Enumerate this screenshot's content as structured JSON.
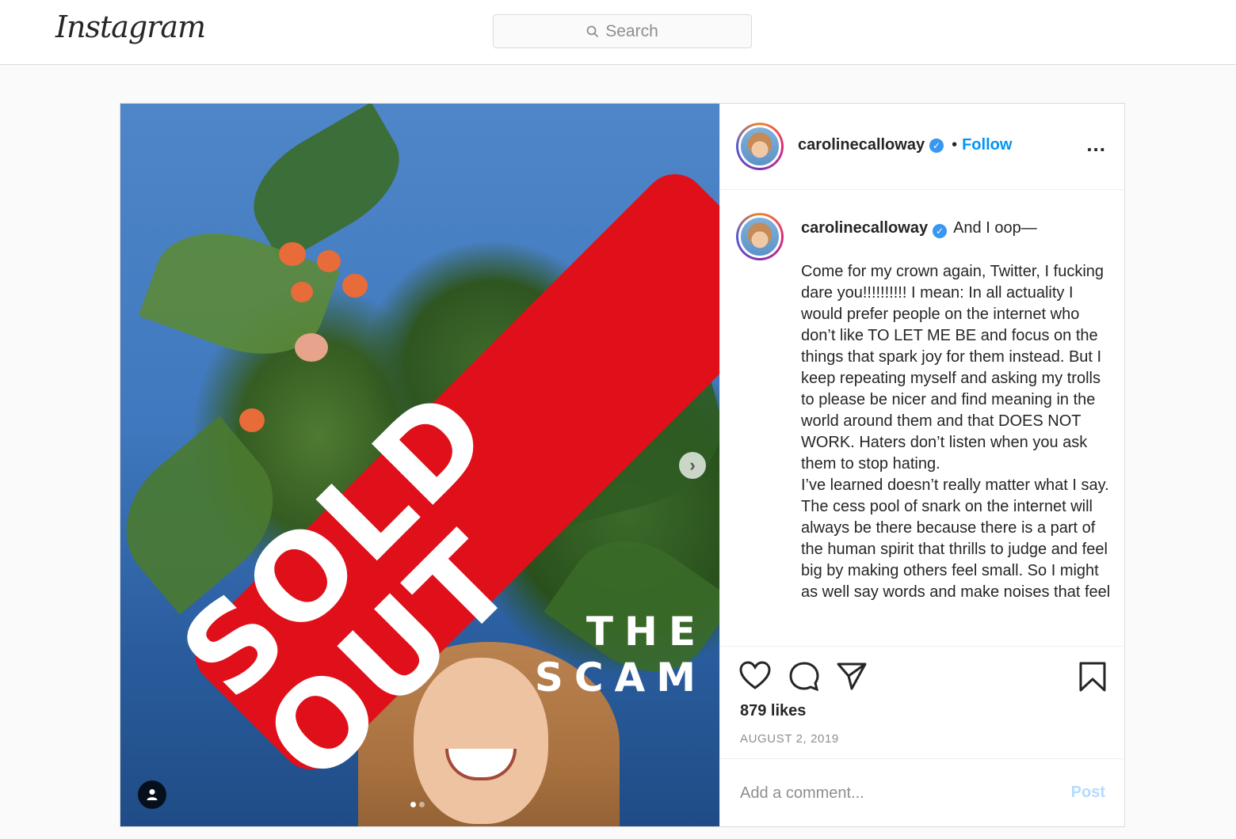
{
  "nav": {
    "logo": "Instagram",
    "search_placeholder": "Search"
  },
  "post": {
    "image": {
      "overlay_text": "SOLD OUT",
      "subtitle": "THE SCAM",
      "carousel_count": 2,
      "carousel_active": 1
    },
    "header": {
      "username": "carolinecalloway",
      "separator": "•",
      "follow_label": "Follow",
      "more_label": "..."
    },
    "caption": {
      "username": "carolinecalloway",
      "title": "And I oop—",
      "body": "Come for my crown again, Twitter, I fucking dare you!!!!!!!!!! I mean: In all actuality I would prefer people on the internet who don’t like TO LET ME BE and focus on the things that spark joy for them instead. But I keep repeating myself and asking my trolls to please be nicer and find meaning in the world around them and that DOES NOT WORK. Haters don’t listen when you ask them to stop hating.\nI’ve learned doesn’t really matter what I say. The cess pool of snark on the internet will always be there because there is a part of the human spirit that thrills to judge and feel big by making others feel small. So I might as well say words and make noises that feel"
    },
    "likes": "879 likes",
    "date": "AUGUST 2, 2019",
    "comment": {
      "placeholder": "Add a comment...",
      "post_label": "Post"
    }
  },
  "colors": {
    "accent": "#0095f6",
    "post_disabled": "#b3dbff",
    "sold_out_red": "#e0101a",
    "muted": "#8e8e8e"
  }
}
